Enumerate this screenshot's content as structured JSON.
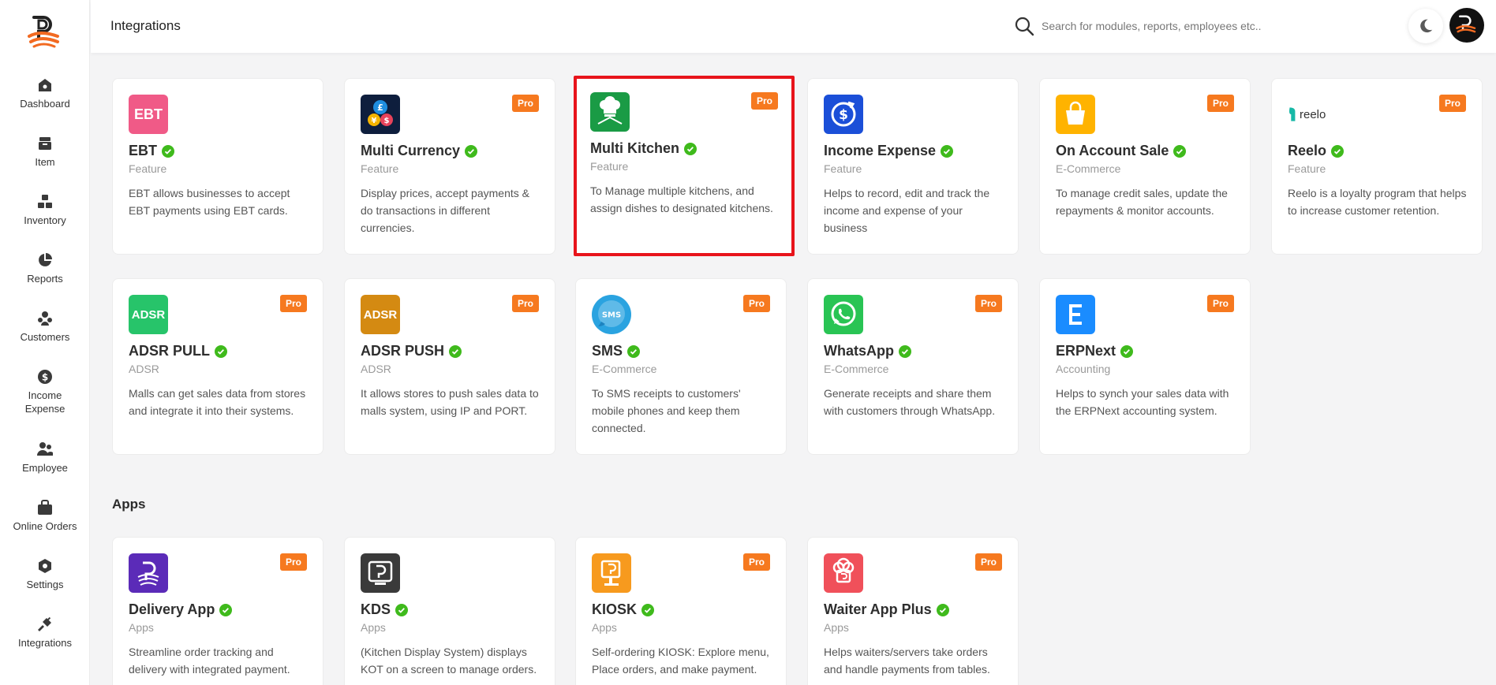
{
  "header": {
    "title": "Integrations",
    "search_placeholder": "Search for modules, reports, employees etc.."
  },
  "sidebar": {
    "items": [
      {
        "label": "Dashboard",
        "icon": "dashboard-icon"
      },
      {
        "label": "Item",
        "icon": "item-icon"
      },
      {
        "label": "Inventory",
        "icon": "inventory-icon"
      },
      {
        "label": "Reports",
        "icon": "reports-icon"
      },
      {
        "label": "Customers",
        "icon": "customers-icon"
      },
      {
        "label": "Income Expense",
        "icon": "income-expense-icon"
      },
      {
        "label": "Employee",
        "icon": "employee-icon"
      },
      {
        "label": "Online Orders",
        "icon": "online-orders-icon"
      },
      {
        "label": "Settings",
        "icon": "settings-icon"
      },
      {
        "label": "Integrations",
        "icon": "integrations-icon"
      }
    ]
  },
  "badge_label": "Pro",
  "colors": {
    "pro_badge": "#f6791f",
    "check": "#3fba1c",
    "highlight_border": "#e8141b"
  },
  "integrations": [
    {
      "title": "EBT",
      "category": "Feature",
      "description": "EBT allows businesses to accept EBT payments using EBT cards.",
      "icon_text": "EBT"
    },
    {
      "title": "Multi Currency",
      "category": "Feature",
      "description": "Display prices, accept payments & do transactions in different currencies."
    },
    {
      "title": "Multi Kitchen",
      "category": "Feature",
      "description": "To Manage multiple kitchens, and assign dishes to designated kitchens."
    },
    {
      "title": "Income Expense",
      "category": "Feature",
      "description": "Helps to record, edit and track the income and expense of your business"
    },
    {
      "title": "On Account Sale",
      "category": "E-Commerce",
      "description": "To manage credit sales, update the repayments & monitor accounts."
    },
    {
      "title": "Reelo",
      "category": "Feature",
      "description": "Reelo is a loyalty program that helps to increase customer retention.",
      "icon_text": "reelo"
    },
    {
      "title": "ADSR PULL",
      "category": "ADSR",
      "description": "Malls can get sales data from stores and integrate it into their systems.",
      "icon_text": "ADSR"
    },
    {
      "title": "ADSR PUSH",
      "category": "ADSR",
      "description": "It allows stores to push sales data to malls system, using IP and PORT.",
      "icon_text": "ADSR"
    },
    {
      "title": "SMS",
      "category": "E-Commerce",
      "description": "To SMS receipts to customers' mobile phones and keep them connected.",
      "icon_text": "SMS"
    },
    {
      "title": "WhatsApp",
      "category": "E-Commerce",
      "description": "Generate receipts and share them with customers through WhatsApp."
    },
    {
      "title": "ERPNext",
      "category": "Accounting",
      "description": "Helps to synch your sales data with the ERPNext accounting system."
    }
  ],
  "apps_section": {
    "title": "Apps",
    "items": [
      {
        "title": "Delivery App",
        "category": "Apps",
        "description": "Streamline order tracking and delivery with integrated payment."
      },
      {
        "title": "KDS",
        "category": "Apps",
        "description": "(Kitchen Display System) displays KOT on a screen to manage orders."
      },
      {
        "title": "KIOSK",
        "category": "Apps",
        "description": "Self-ordering KIOSK: Explore menu, Place orders, and make payment."
      },
      {
        "title": "Waiter App Plus",
        "category": "Apps",
        "description": "Helps waiters/servers take orders and handle payments from tables."
      }
    ]
  }
}
